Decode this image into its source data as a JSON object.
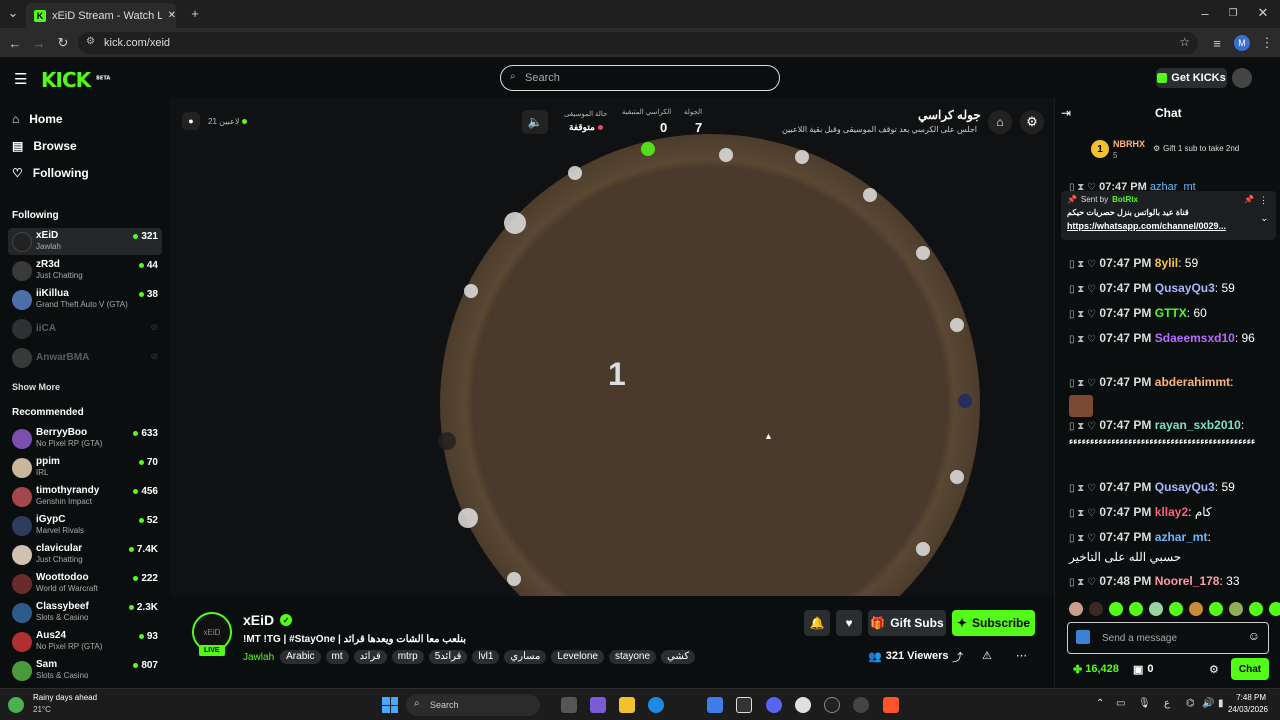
{
  "browser": {
    "tab_title": "xEiD Stream - Watch Live o",
    "url": "kick.com/xeid",
    "profile_initial": "M"
  },
  "header": {
    "logo": "KICK",
    "logo_badge": "BETA",
    "search_placeholder": "Search",
    "get_kicks": "Get KICKs"
  },
  "sidebar": {
    "nav": [
      {
        "label": "Home",
        "icon": "home-icon"
      },
      {
        "label": "Browse",
        "icon": "browse-icon"
      },
      {
        "label": "Following",
        "icon": "heart-icon"
      }
    ],
    "following_title": "Following",
    "following": [
      {
        "name": "xEiD",
        "category": "Jawlah",
        "viewers": "321",
        "avatar_color": "#222222",
        "live": true
      },
      {
        "name": "zR3d",
        "category": "Just Chatting",
        "viewers": "44",
        "avatar_color": "#3a3a3a",
        "live": true
      },
      {
        "name": "iiKillua",
        "category": "Grand Theft Auto V (GTA)",
        "viewers": "38",
        "avatar_color": "#4b6fa8",
        "live": true
      },
      {
        "name": "iiCA",
        "category": "",
        "viewers": "",
        "avatar_color": "#555555",
        "live": false
      },
      {
        "name": "AnwarBMA",
        "category": "",
        "viewers": "",
        "avatar_color": "#666666",
        "live": false
      }
    ],
    "show_more": "Show More",
    "recommended_title": "Recommended",
    "recommended": [
      {
        "name": "BerryyBoo",
        "category": "No Pixel RP (GTA)",
        "viewers": "633",
        "avatar_color": "#7a4fb0"
      },
      {
        "name": "ppim",
        "category": "IRL",
        "viewers": "70",
        "avatar_color": "#c9b79c"
      },
      {
        "name": "timothyrandy",
        "category": "Genshin Impact",
        "viewers": "456",
        "avatar_color": "#a3474b"
      },
      {
        "name": "iGypC",
        "category": "Marvel Rivals",
        "viewers": "52",
        "avatar_color": "#2c3c5a"
      },
      {
        "name": "clavicular",
        "category": "Just Chatting",
        "viewers": "7.4K",
        "avatar_color": "#cfc3b0"
      },
      {
        "name": "Woottodoo",
        "category": "World of Warcraft",
        "viewers": "222",
        "avatar_color": "#6b2b2b"
      },
      {
        "name": "Classybeef",
        "category": "Slots & Casino",
        "viewers": "2.3K",
        "avatar_color": "#2e5c8a"
      },
      {
        "name": "Aus24",
        "category": "No Pixel RP (GTA)",
        "viewers": "93",
        "avatar_color": "#b03030"
      },
      {
        "name": "Sam",
        "category": "Slots & Casino",
        "viewers": "807",
        "avatar_color": "#4c9a3a"
      }
    ]
  },
  "stream_overlay": {
    "players": "21 لاعبين",
    "music_status_label": "حالة الموسيقى",
    "music_status": "متوقفة",
    "remaining_chairs_label": "الكراسي المتبقية",
    "remaining_chairs": "0",
    "round_label": "الجولة",
    "round": "7",
    "game_title": "جوله كراسي",
    "game_desc": "اجلس على الكرسي بعد توقف الموسيقى وقبل بقية اللاعبين",
    "countdown": "1"
  },
  "stream_info": {
    "streamer": "xEiD",
    "live_badge": "LIVE",
    "title": "!MT !TG | #StayOne | بنلعب معا الشات ويعدها قرائد",
    "category": "Jawlah",
    "tags": [
      "Arabic",
      "mt",
      "قرائد",
      "mtrp",
      "قرائد5",
      "lvl1",
      "مساري",
      "Levelone",
      "stayone",
      "كشي"
    ],
    "gift_subs": "Gift Subs",
    "subscribe": "Subscribe",
    "viewers": "321 Viewers"
  },
  "chat": {
    "title": "Chat",
    "top_gifter_name": "NBRHX",
    "top_gifter_rank": "1",
    "top_gifter_count": "5",
    "gift_prompt": "Gift 1 sub to take 2nd",
    "pinned_sent_by": "Sent by",
    "pinned_bot": "BotRix",
    "pinned_text": "قناة عيد بالواتس بنزل حصريات حيكم",
    "pinned_link": "https://whatsapp.com/channel/0029...",
    "partial_user": "azhar_mt",
    "messages": [
      {
        "time": "07:47 PM",
        "user": "8ylil",
        "color": "#f5c542",
        "text": "59"
      },
      {
        "time": "07:47 PM",
        "user": "QusayQu3",
        "color": "#a7b8ff",
        "text": "59"
      },
      {
        "time": "07:47 PM",
        "user": "GTTX",
        "color": "#53fc18",
        "text": "60"
      },
      {
        "time": "07:47 PM",
        "user": "Sdaeemsxd10",
        "color": "#b66bff",
        "text": "96"
      },
      {
        "time": "07:47 PM",
        "user": "abderahimmt",
        "color": "#ffb27a",
        "text": ""
      },
      {
        "time": "07:47 PM",
        "user": "rayan_sxb2010",
        "color": "#7de0c8",
        "text": "ءءءءءءءءءءءءءءءءءءءءءءءءءءءءءءءءءءءءءءءءءءءء"
      },
      {
        "time": "07:47 PM",
        "user": "QusayQu3",
        "color": "#a7b8ff",
        "text": "59"
      },
      {
        "time": "07:47 PM",
        "user": "kllay2",
        "color": "#ff5f7a",
        "text": "كام"
      },
      {
        "time": "07:47 PM",
        "user": "azhar_mt",
        "color": "#6bb8ff",
        "text": "حسبي الله على التاخير"
      },
      {
        "time": "07:48 PM",
        "user": "Noorel_178",
        "color": "#ff9aa8",
        "text": "33"
      }
    ],
    "input_placeholder": "Send a message",
    "points": "16,428",
    "redemptions": "0",
    "send_button": "Chat"
  },
  "taskbar": {
    "weather_title": "Rainy days ahead",
    "weather_temp": "21°C",
    "search_placeholder": "Search",
    "time": "7:48 PM",
    "date": "24/03/2026",
    "lang": "ع"
  },
  "colors": {
    "accent": "#53fc18",
    "background": "#0b0e0f",
    "panel": "#2a2e30"
  }
}
